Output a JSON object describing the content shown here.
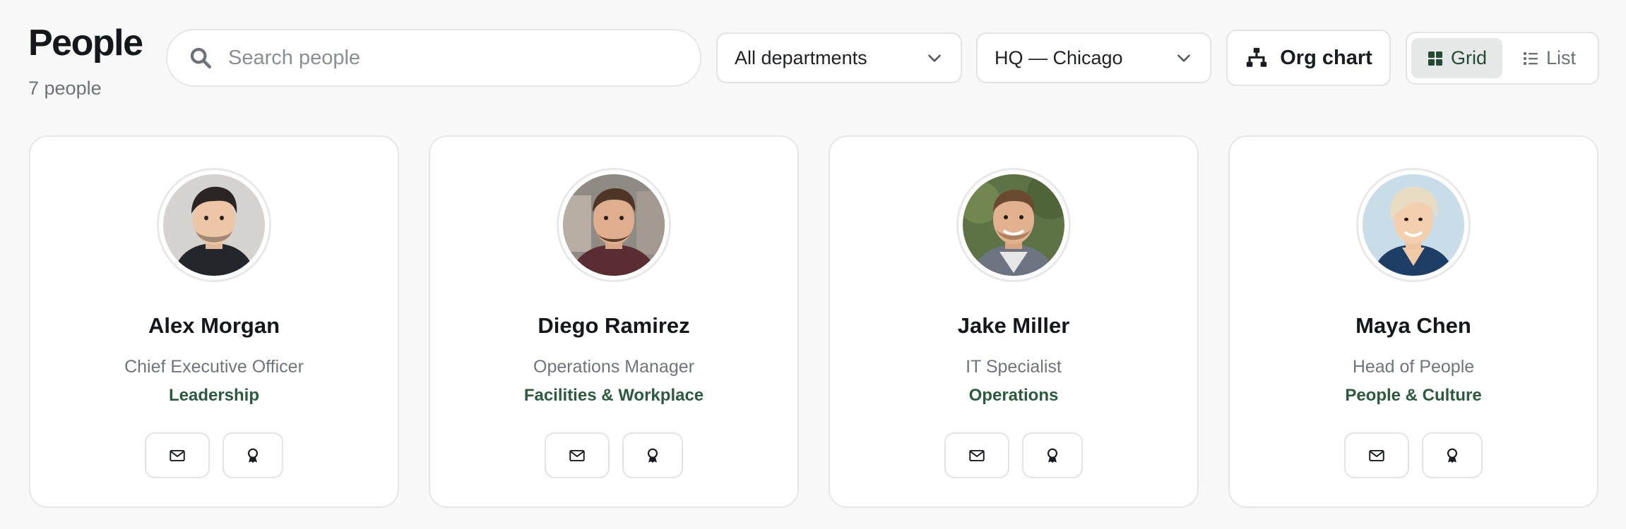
{
  "header": {
    "title": "People",
    "count": "7 people"
  },
  "search": {
    "placeholder": "Search people",
    "value": ""
  },
  "filters": {
    "department": "All departments",
    "location": "HQ — Chicago"
  },
  "org_chart_label": "Org chart",
  "view_toggle": {
    "grid_label": "Grid",
    "list_label": "List",
    "selected": "Grid"
  },
  "people": [
    {
      "name": "Alex Morgan",
      "title": "Chief Executive Officer",
      "department": "Leadership"
    },
    {
      "name": "Diego Ramirez",
      "title": "Operations Manager",
      "department": "Facilities & Workplace"
    },
    {
      "name": "Jake Miller",
      "title": "IT Specialist",
      "department": "Operations"
    },
    {
      "name": "Maya Chen",
      "title": "Head of People",
      "department": "People & Culture"
    }
  ],
  "colors": {
    "accent": "#2d5a3f",
    "grid_active_bg": "#e5e8e6",
    "page_bg": "#f8f8f8"
  },
  "icons": {
    "search": "search-icon",
    "dropdown": "chevron-down-icon",
    "org_chart": "org-chart-icon",
    "grid": "grid-icon",
    "list": "list-icon",
    "email": "mail-icon",
    "award": "award-icon"
  }
}
